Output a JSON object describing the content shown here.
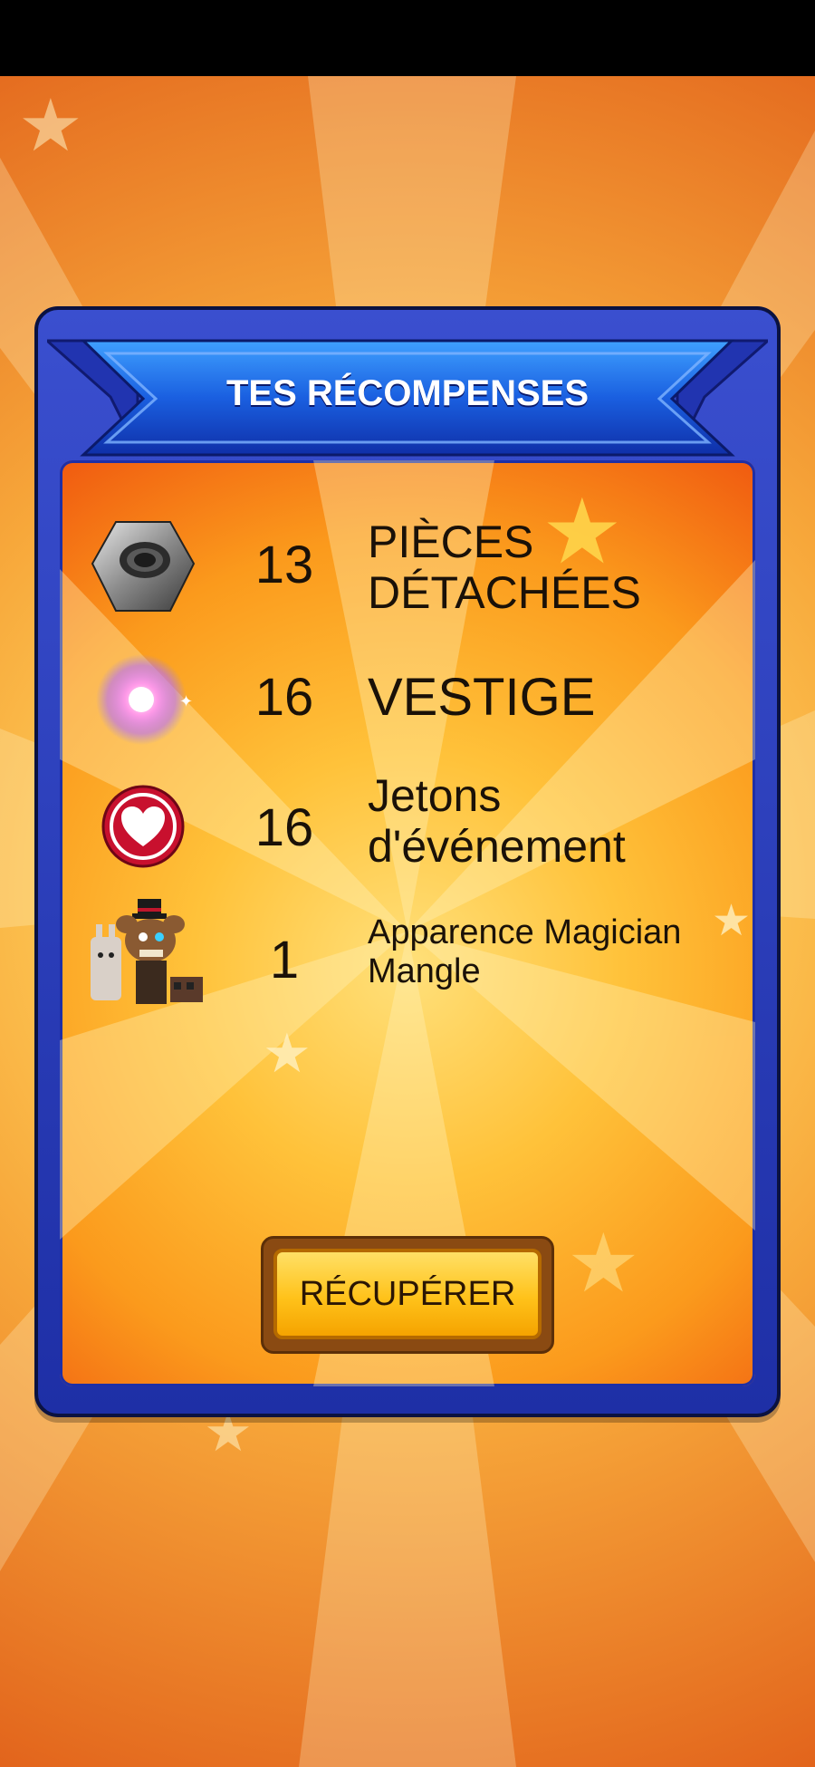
{
  "title": "TES RÉCOMPENSES",
  "rewards": [
    {
      "icon": "hex-nut-icon",
      "quantity": "13",
      "line1": "PIÈCES",
      "line2": "DÉTACHÉES"
    },
    {
      "icon": "pink-sparkle-orb-icon",
      "quantity": "16",
      "line1": "VESTIGE",
      "line2": ""
    },
    {
      "icon": "heart-token-icon",
      "quantity": "16",
      "line1": "Jetons",
      "line2": "d'événement"
    },
    {
      "icon": "animatronic-skin-icon",
      "quantity": "1",
      "line1": "Apparence Magician",
      "line2": "Mangle"
    }
  ],
  "claim_button_label": "RÉCUPÉRER",
  "colors": {
    "panel_blue": "#2a3cc0",
    "banner_blue": "#1f6fe6",
    "button_yellow": "#ffc21a",
    "background_orange": "#f7a73a"
  }
}
